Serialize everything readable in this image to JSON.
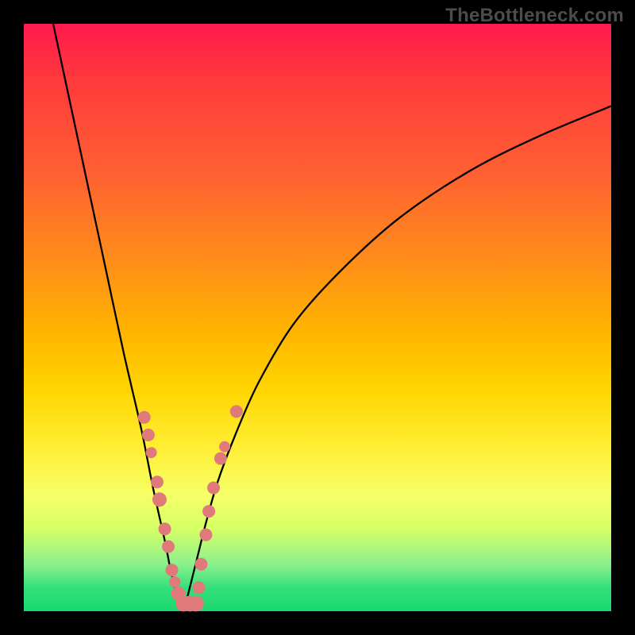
{
  "watermark": "TheBottleneck.com",
  "colors": {
    "frame": "#000000",
    "curve": "#000000",
    "dot": "#e07a7a",
    "gradient_top": "#ff1a4d",
    "gradient_bottom": "#19d871"
  },
  "chart_data": {
    "type": "line",
    "title": "",
    "xlabel": "",
    "ylabel": "",
    "xlim": [
      0,
      100
    ],
    "ylim": [
      0,
      100
    ],
    "notes": "Two curves (descending and ascending) meeting near (27, 0). Y=0 at bottom (green), Y=100 at top (red). No numeric axis labels are visible in the image; values are estimated from pixel positions.",
    "series": [
      {
        "name": "left-curve",
        "x": [
          5,
          8,
          11,
          14,
          17,
          20,
          22,
          24,
          25,
          26,
          27.2
        ],
        "y": [
          100,
          86,
          72,
          58,
          44,
          31,
          21,
          12,
          7,
          3,
          0
        ]
      },
      {
        "name": "right-curve",
        "x": [
          27.2,
          28,
          29.5,
          31,
          33,
          36,
          40,
          46,
          54,
          64,
          76,
          88,
          100
        ],
        "y": [
          0,
          3,
          9,
          15,
          22,
          30,
          39,
          49,
          58,
          67,
          75,
          81,
          86
        ]
      }
    ],
    "scatter": {
      "name": "dots",
      "points": [
        {
          "x": 20.5,
          "y": 33,
          "r": 8
        },
        {
          "x": 21.2,
          "y": 30,
          "r": 8
        },
        {
          "x": 21.7,
          "y": 27,
          "r": 7
        },
        {
          "x": 22.7,
          "y": 22,
          "r": 8
        },
        {
          "x": 23.1,
          "y": 19,
          "r": 9
        },
        {
          "x": 24.0,
          "y": 14,
          "r": 8
        },
        {
          "x": 24.6,
          "y": 11,
          "r": 8
        },
        {
          "x": 25.2,
          "y": 7,
          "r": 8
        },
        {
          "x": 25.7,
          "y": 5,
          "r": 7
        },
        {
          "x": 26.3,
          "y": 3,
          "r": 9
        },
        {
          "x": 27.2,
          "y": 1.3,
          "r": 10
        },
        {
          "x": 28.3,
          "y": 1.3,
          "r": 10
        },
        {
          "x": 29.3,
          "y": 1.3,
          "r": 10
        },
        {
          "x": 29.8,
          "y": 4,
          "r": 8
        },
        {
          "x": 30.2,
          "y": 8,
          "r": 8
        },
        {
          "x": 31.0,
          "y": 13,
          "r": 8
        },
        {
          "x": 31.5,
          "y": 17,
          "r": 8
        },
        {
          "x": 32.3,
          "y": 21,
          "r": 8
        },
        {
          "x": 33.5,
          "y": 26,
          "r": 8
        },
        {
          "x": 34.2,
          "y": 28,
          "r": 7
        },
        {
          "x": 36.2,
          "y": 34,
          "r": 8
        }
      ]
    }
  }
}
